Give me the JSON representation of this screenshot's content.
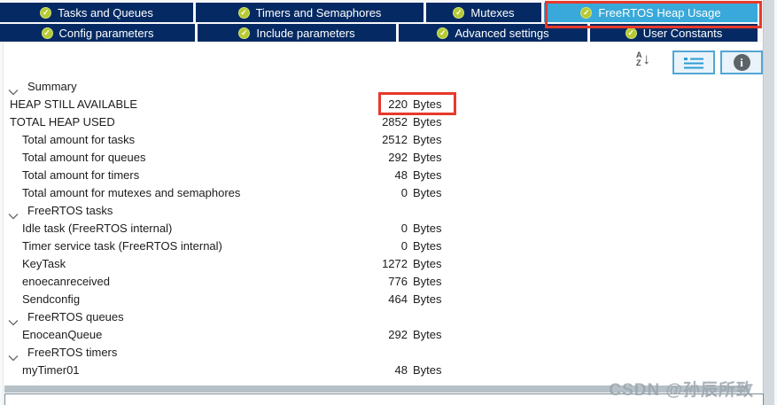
{
  "tabs": {
    "row1": [
      {
        "label": "Tasks and Queues",
        "active": false
      },
      {
        "label": "Timers and Semaphores",
        "active": false
      },
      {
        "label": "Mutexes",
        "active": false
      },
      {
        "label": "FreeRTOS Heap Usage",
        "active": true,
        "annotated": true
      }
    ],
    "row2": [
      {
        "label": "Config parameters",
        "active": false
      },
      {
        "label": "Include parameters",
        "active": false
      },
      {
        "label": "Advanced settings",
        "active": false
      },
      {
        "label": "User Constants",
        "active": false
      }
    ],
    "status_icon": "check-circle-icon",
    "check_color": "#b6ca33"
  },
  "toolbar": {
    "sort_icon": "sort-az-icon",
    "sort_letters": {
      "a": "A",
      "z": "Z",
      "arrow": "↓"
    },
    "expand_button_icon": "tree-list-icon",
    "info_button_icon": "info-icon",
    "info_glyph": "i",
    "button_border_color": "#53a6d2"
  },
  "tree": {
    "rows": [
      {
        "type": "group",
        "label": "Summary"
      },
      {
        "type": "item",
        "indent": 0,
        "label": "HEAP STILL AVAILABLE",
        "value": "220",
        "unit": "Bytes",
        "annotated": true
      },
      {
        "type": "item",
        "indent": 0,
        "label": "TOTAL HEAP USED",
        "value": "2852",
        "unit": "Bytes"
      },
      {
        "type": "item",
        "indent": 1,
        "label": "Total amount for tasks",
        "value": "2512",
        "unit": "Bytes"
      },
      {
        "type": "item",
        "indent": 1,
        "label": "Total amount for queues",
        "value": "292",
        "unit": "Bytes"
      },
      {
        "type": "item",
        "indent": 1,
        "label": "Total amount for timers",
        "value": "48",
        "unit": "Bytes"
      },
      {
        "type": "item",
        "indent": 1,
        "label": "Total amount for mutexes and semaphores",
        "value": "0",
        "unit": "Bytes"
      },
      {
        "type": "group",
        "label": "FreeRTOS tasks"
      },
      {
        "type": "item",
        "indent": 1,
        "label": "Idle task (FreeRTOS internal)",
        "value": "0",
        "unit": "Bytes"
      },
      {
        "type": "item",
        "indent": 1,
        "label": "Timer service task (FreeRTOS internal)",
        "value": "0",
        "unit": "Bytes"
      },
      {
        "type": "item",
        "indent": 1,
        "label": "KeyTask",
        "value": "1272",
        "unit": "Bytes"
      },
      {
        "type": "item",
        "indent": 1,
        "label": "enoecanreceived",
        "value": "776",
        "unit": "Bytes"
      },
      {
        "type": "item",
        "indent": 1,
        "label": "Sendconfig",
        "value": "464",
        "unit": "Bytes"
      },
      {
        "type": "group",
        "label": "FreeRTOS queues"
      },
      {
        "type": "item",
        "indent": 1,
        "label": "EnoceanQueue",
        "value": "292",
        "unit": "Bytes"
      },
      {
        "type": "group",
        "label": "FreeRTOS timers"
      },
      {
        "type": "item",
        "indent": 1,
        "label": "myTimer01",
        "value": "48",
        "unit": "Bytes"
      }
    ],
    "group_icon": "chevron-down-icon"
  },
  "annotations": {
    "color": "#e8392b",
    "tab_highlight": "FreeRTOS Heap Usage",
    "value_highlight": "220 Bytes"
  },
  "watermark": "CSDN @孙辰所致",
  "colors": {
    "tab_inactive": "#052a63",
    "tab_active": "#38a9da",
    "annotation_red": "#e8392b",
    "check_green": "#b6ca33",
    "text": "#1c1c1c"
  }
}
